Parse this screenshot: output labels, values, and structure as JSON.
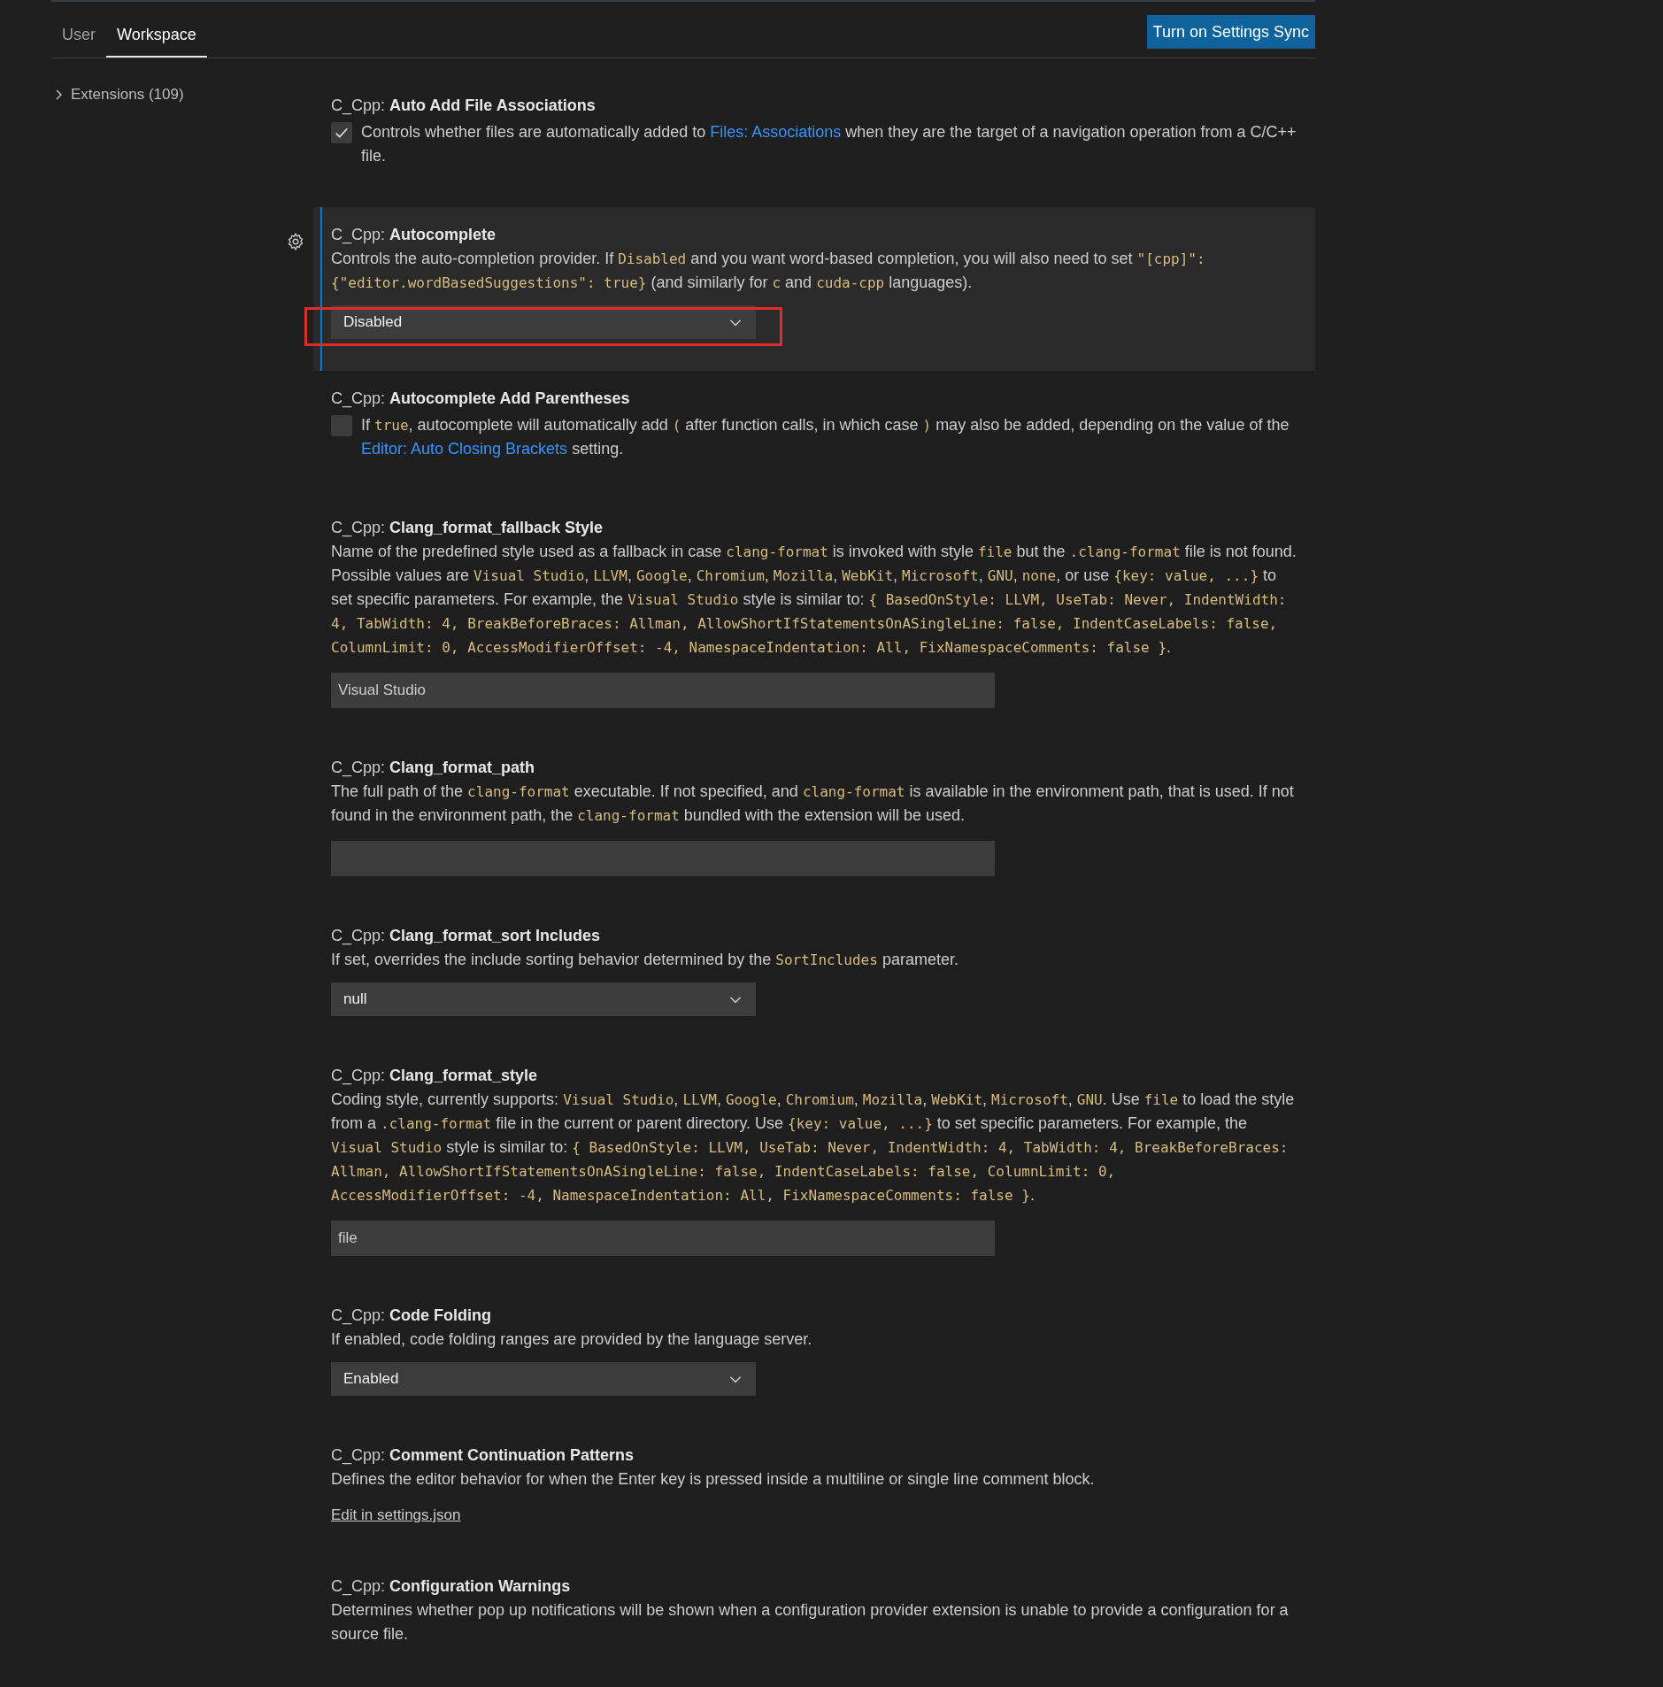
{
  "tabs": [
    {
      "label": "User",
      "selected": false
    },
    {
      "label": "Workspace",
      "selected": true
    }
  ],
  "sync_button": "Turn on Settings Sync",
  "sidebar": {
    "items": [
      {
        "label": "Extensions (109)",
        "expanded": false
      }
    ]
  },
  "settings": [
    {
      "prefix": "C_Cpp: ",
      "name": "Auto Add File Associations",
      "kind": "checkbox",
      "checked": true,
      "focused": false,
      "highlighted": false,
      "description": [
        {
          "kind": "text",
          "s": "Controls whether files are automatically added to "
        },
        {
          "kind": "link",
          "s": "Files: Associations"
        },
        {
          "kind": "text",
          "s": " when they are the target of a navigation operation from a C/C++ file."
        }
      ]
    },
    {
      "prefix": "C_Cpp: ",
      "name": "Autocomplete",
      "kind": "dropdown",
      "value": "Disabled",
      "focused": true,
      "highlighted": true,
      "description": [
        {
          "kind": "text",
          "s": "Controls the auto-completion provider. If "
        },
        {
          "kind": "code",
          "s": "Disabled"
        },
        {
          "kind": "text",
          "s": " and you want word-based completion, you will also need to set "
        },
        {
          "kind": "code",
          "s": "\"[cpp]\": {\"editor.wordBasedSuggestions\": true}"
        },
        {
          "kind": "text",
          "s": " (and similarly for "
        },
        {
          "kind": "code",
          "s": "c"
        },
        {
          "kind": "text",
          "s": " and "
        },
        {
          "kind": "code",
          "s": "cuda-cpp"
        },
        {
          "kind": "text",
          "s": " languages)."
        }
      ]
    },
    {
      "prefix": "C_Cpp: ",
      "name": "Autocomplete Add Parentheses",
      "kind": "checkbox",
      "checked": false,
      "focused": false,
      "highlighted": false,
      "description": [
        {
          "kind": "text",
          "s": "If "
        },
        {
          "kind": "code",
          "s": "true"
        },
        {
          "kind": "text",
          "s": ", autocomplete will automatically add "
        },
        {
          "kind": "code",
          "s": "("
        },
        {
          "kind": "text",
          "s": " after function calls, in which case "
        },
        {
          "kind": "code",
          "s": ")"
        },
        {
          "kind": "text",
          "s": " may also be added, depending on the value of the "
        },
        {
          "kind": "link",
          "s": "Editor: Auto Closing Brackets"
        },
        {
          "kind": "text",
          "s": " setting."
        }
      ]
    },
    {
      "prefix": "C_Cpp: ",
      "name": "Clang_format_fallback Style",
      "kind": "text",
      "value": "Visual Studio",
      "focused": false,
      "highlighted": false,
      "description": [
        {
          "kind": "text",
          "s": "Name of the predefined style used as a fallback in case "
        },
        {
          "kind": "code",
          "s": "clang-format"
        },
        {
          "kind": "text",
          "s": " is invoked with style "
        },
        {
          "kind": "code",
          "s": "file"
        },
        {
          "kind": "text",
          "s": " but the "
        },
        {
          "kind": "code",
          "s": ".clang-format"
        },
        {
          "kind": "text",
          "s": " file is not found. Possible values are "
        },
        {
          "kind": "code",
          "s": "Visual Studio"
        },
        {
          "kind": "text",
          "s": ", "
        },
        {
          "kind": "code",
          "s": "LLVM"
        },
        {
          "kind": "text",
          "s": ", "
        },
        {
          "kind": "code",
          "s": "Google"
        },
        {
          "kind": "text",
          "s": ", "
        },
        {
          "kind": "code",
          "s": "Chromium"
        },
        {
          "kind": "text",
          "s": ", "
        },
        {
          "kind": "code",
          "s": "Mozilla"
        },
        {
          "kind": "text",
          "s": ", "
        },
        {
          "kind": "code",
          "s": "WebKit"
        },
        {
          "kind": "text",
          "s": ", "
        },
        {
          "kind": "code",
          "s": "Microsoft"
        },
        {
          "kind": "text",
          "s": ", "
        },
        {
          "kind": "code",
          "s": "GNU"
        },
        {
          "kind": "text",
          "s": ", "
        },
        {
          "kind": "code",
          "s": "none"
        },
        {
          "kind": "text",
          "s": ", or use "
        },
        {
          "kind": "code",
          "s": "{key: value, ...}"
        },
        {
          "kind": "text",
          "s": " to set specific parameters. For example, the "
        },
        {
          "kind": "code",
          "s": "Visual Studio"
        },
        {
          "kind": "text",
          "s": " style is similar to: "
        },
        {
          "kind": "code",
          "s": "{ BasedOnStyle: LLVM, UseTab: Never, IndentWidth: 4, TabWidth: 4, BreakBeforeBraces: Allman, AllowShortIfStatementsOnASingleLine: false, IndentCaseLabels: false, ColumnLimit: 0, AccessModifierOffset: -4, NamespaceIndentation: All, FixNamespaceComments: false }"
        },
        {
          "kind": "text",
          "s": "."
        }
      ]
    },
    {
      "prefix": "C_Cpp: ",
      "name": "Clang_format_path",
      "kind": "text",
      "focused": false,
      "highlighted": false,
      "description": [
        {
          "kind": "text",
          "s": "The full path of the "
        },
        {
          "kind": "code",
          "s": "clang-format"
        },
        {
          "kind": "text",
          "s": " executable. If not specified, and "
        },
        {
          "kind": "code",
          "s": "clang-format"
        },
        {
          "kind": "text",
          "s": " is available in the environment path, that is used. If not found in the environment path, the "
        },
        {
          "kind": "code",
          "s": "clang-format"
        },
        {
          "kind": "text",
          "s": " bundled with the extension will be used."
        }
      ]
    },
    {
      "prefix": "C_Cpp: ",
      "name": "Clang_format_sort Includes",
      "kind": "dropdown",
      "value": "null",
      "focused": false,
      "highlighted": false,
      "description": [
        {
          "kind": "text",
          "s": "If set, overrides the include sorting behavior determined by the "
        },
        {
          "kind": "code",
          "s": "SortIncludes"
        },
        {
          "kind": "text",
          "s": " parameter."
        }
      ]
    },
    {
      "prefix": "C_Cpp: ",
      "name": "Clang_format_style",
      "kind": "text",
      "value": "file",
      "focused": false,
      "highlighted": false,
      "description": [
        {
          "kind": "text",
          "s": "Coding style, currently supports: "
        },
        {
          "kind": "code",
          "s": "Visual Studio"
        },
        {
          "kind": "text",
          "s": ", "
        },
        {
          "kind": "code",
          "s": "LLVM"
        },
        {
          "kind": "text",
          "s": ", "
        },
        {
          "kind": "code",
          "s": "Google"
        },
        {
          "kind": "text",
          "s": ", "
        },
        {
          "kind": "code",
          "s": "Chromium"
        },
        {
          "kind": "text",
          "s": ", "
        },
        {
          "kind": "code",
          "s": "Mozilla"
        },
        {
          "kind": "text",
          "s": ", "
        },
        {
          "kind": "code",
          "s": "WebKit"
        },
        {
          "kind": "text",
          "s": ", "
        },
        {
          "kind": "code",
          "s": "Microsoft"
        },
        {
          "kind": "text",
          "s": ", "
        },
        {
          "kind": "code",
          "s": "GNU"
        },
        {
          "kind": "text",
          "s": ". Use "
        },
        {
          "kind": "code",
          "s": "file"
        },
        {
          "kind": "text",
          "s": " to load the style from a "
        },
        {
          "kind": "code",
          "s": ".clang-format"
        },
        {
          "kind": "text",
          "s": " file in the current or parent directory. Use "
        },
        {
          "kind": "code",
          "s": "{key: value, ...}"
        },
        {
          "kind": "text",
          "s": " to set specific parameters. For example, the "
        },
        {
          "kind": "code",
          "s": "Visual Studio"
        },
        {
          "kind": "text",
          "s": " style is similar to: "
        },
        {
          "kind": "code",
          "s": "{ BasedOnStyle: LLVM, UseTab: Never, IndentWidth: 4, TabWidth: 4, BreakBeforeBraces: Allman, AllowShortIfStatementsOnASingleLine: false, IndentCaseLabels: false, ColumnLimit: 0, AccessModifierOffset: -4, NamespaceIndentation: All, FixNamespaceComments: false }"
        },
        {
          "kind": "text",
          "s": "."
        }
      ]
    },
    {
      "prefix": "C_Cpp: ",
      "name": "Code Folding",
      "kind": "dropdown",
      "value": "Enabled",
      "focused": false,
      "highlighted": false,
      "description": [
        {
          "kind": "text",
          "s": "If enabled, code folding ranges are provided by the language server."
        }
      ]
    },
    {
      "prefix": "C_Cpp: ",
      "name": "Comment Continuation Patterns",
      "kind": "link",
      "value": "Edit in settings.json",
      "focused": false,
      "highlighted": false,
      "description": [
        {
          "kind": "text",
          "s": "Defines the editor behavior for when the Enter key is pressed inside a multiline or single line comment block."
        }
      ]
    },
    {
      "prefix": "C_Cpp: ",
      "name": "Configuration Warnings",
      "kind": "none",
      "focused": false,
      "highlighted": false,
      "description": [
        {
          "kind": "text",
          "s": "Determines whether pop up notifications will be shown when a configuration provider extension is unable to provide a configuration for a source file."
        }
      ]
    }
  ]
}
